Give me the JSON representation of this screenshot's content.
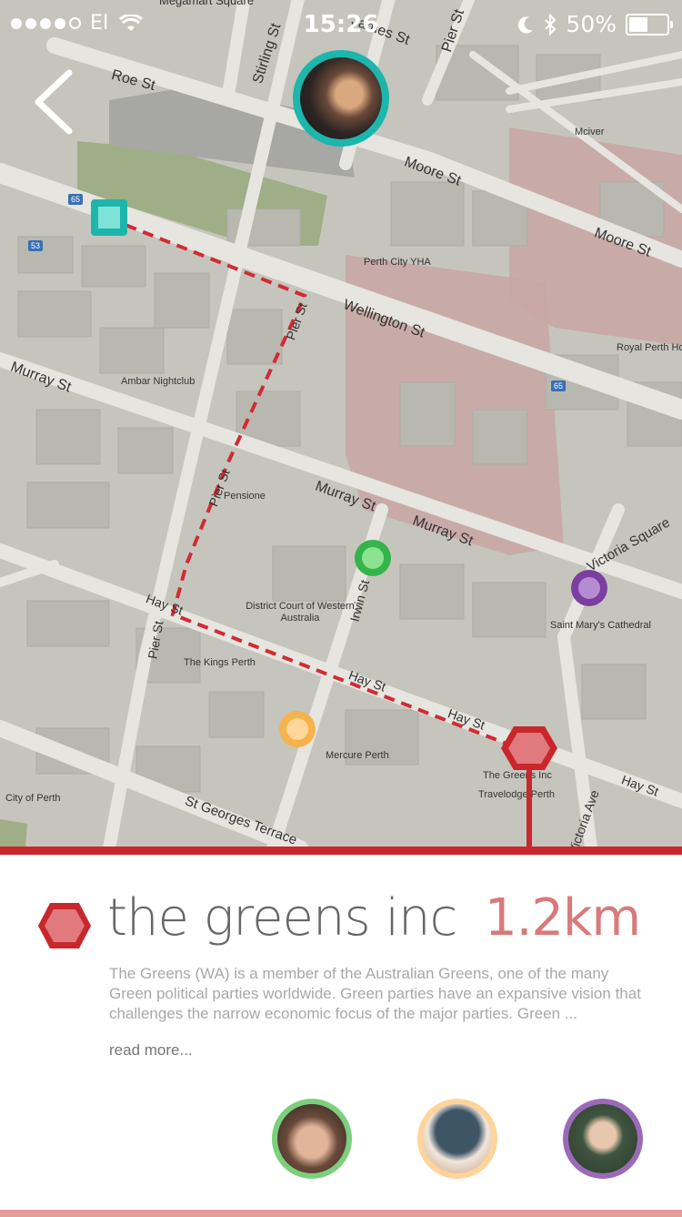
{
  "status_bar": {
    "carrier": "EI",
    "time": "15:26",
    "battery": "50%"
  },
  "map": {
    "streets": [
      "Megamart Square",
      "Roe St",
      "Stirling St",
      "James St",
      "Pier St",
      "Moore St",
      "Moore St",
      "Wellington St",
      "Murray St",
      "Murray St",
      "Murray St",
      "Pier St",
      "Pier St",
      "Pier St",
      "Irwin St",
      "Hay St",
      "Hay St",
      "Hay St",
      "Hay St",
      "Victoria Square",
      "Victoria Ave",
      "St Georges Terrace"
    ],
    "places": [
      "Mciver",
      "Perth City YHA",
      "Royal Perth Ho",
      "Ambar Nightclub",
      "Pensione",
      "District Court of Western Australia",
      "Saint Mary's Cathedral",
      "The Kings Perth",
      "Mercure Perth",
      "The Greens Inc",
      "Travelodge Perth",
      "City of Perth"
    ],
    "route_shields": [
      "65",
      "53",
      "65"
    ]
  },
  "organization": {
    "name": "the greens inc",
    "distance": "1.2km",
    "description": "The Greens (WA) is a member of the Australian Greens, one of the many Green political parties worldwide. Green parties have an expansive vision that challenges the narrow economic focus of the major parties. Green ...",
    "read_more": "read more..."
  },
  "colors": {
    "accent_red": "#c8272c",
    "teal": "#1cb6ad",
    "green": "#34b44a",
    "purple": "#7a3f9f",
    "orange": "#f6b24b"
  }
}
